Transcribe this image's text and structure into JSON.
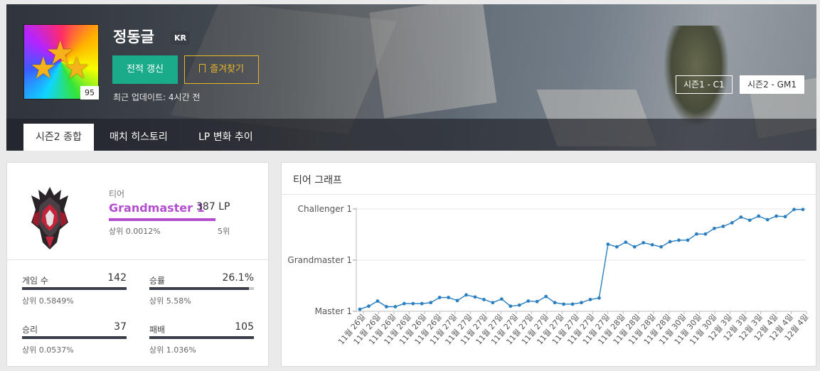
{
  "summoner": {
    "name": "정동글",
    "region": "KR",
    "level": "95",
    "update_button": "전적 갱신",
    "favorite_button": "즐겨찾기",
    "last_update": "최근 업데이트: 4시간 전"
  },
  "seasons": [
    "시즌1 - C1",
    "시즌2 - GM1"
  ],
  "tabs": [
    "시즌2 종합",
    "매치 히스토리",
    "LP 변화 추이"
  ],
  "rank": {
    "tier_label": "티어",
    "tier_name": "Grandmaster 1",
    "lp": "387 LP",
    "percentile": "상위 0.0012%",
    "position": "5위"
  },
  "stats": {
    "games": {
      "label": "게임 수",
      "value": "142",
      "percentile": "상위 0.5849%"
    },
    "winrate": {
      "label": "승률",
      "value": "26.1%",
      "percentile": "상위 5.58%",
      "fill": 0.95
    },
    "wins": {
      "label": "승리",
      "value": "37",
      "percentile": "상위 0.0537%"
    },
    "losses": {
      "label": "패배",
      "value": "105",
      "percentile": "상위 1.036%"
    }
  },
  "colors": {
    "accent_green": "#1aab8a",
    "accent_gold": "#e9b628",
    "tier_purple": "#b44ed1",
    "line_blue": "#2a7fc1"
  },
  "chart_title": "티어 그래프",
  "chart_data": {
    "type": "line",
    "title": "티어 그래프",
    "y_tick_labels": [
      "Master 1",
      "Grandmaster 1",
      "Challenger 1"
    ],
    "ylim": [
      0,
      2
    ],
    "x_tick_labels": [
      "11월 26일",
      "11월 26일",
      "11월 26일",
      "11월 26일",
      "11월 26일",
      "11월 26일",
      "11월 27일",
      "11월 27일",
      "11월 27일",
      "11월 27일",
      "11월 27일",
      "11월 27일",
      "11월 27일",
      "11월 27일",
      "11월 27일",
      "11월 27일",
      "11월 27일",
      "11월 28일",
      "11월 28일",
      "11월 28일",
      "11월 28일",
      "11월 30일",
      "11월 30일",
      "11월 30일",
      "12월 3일",
      "12월 3일",
      "12월 3일",
      "12월 4일",
      "12월 4일",
      "12월 4일"
    ],
    "values": [
      0.04,
      0.1,
      0.2,
      0.09,
      0.09,
      0.15,
      0.15,
      0.15,
      0.17,
      0.27,
      0.27,
      0.21,
      0.32,
      0.28,
      0.23,
      0.17,
      0.24,
      0.1,
      0.12,
      0.2,
      0.19,
      0.29,
      0.17,
      0.14,
      0.14,
      0.17,
      0.23,
      0.26,
      1.31,
      1.26,
      1.35,
      1.26,
      1.34,
      1.3,
      1.26,
      1.36,
      1.39,
      1.39,
      1.51,
      1.51,
      1.62,
      1.66,
      1.73,
      1.84,
      1.78,
      1.86,
      1.79,
      1.86,
      1.85,
      1.99,
      1.99
    ],
    "grid": "horizontal"
  }
}
